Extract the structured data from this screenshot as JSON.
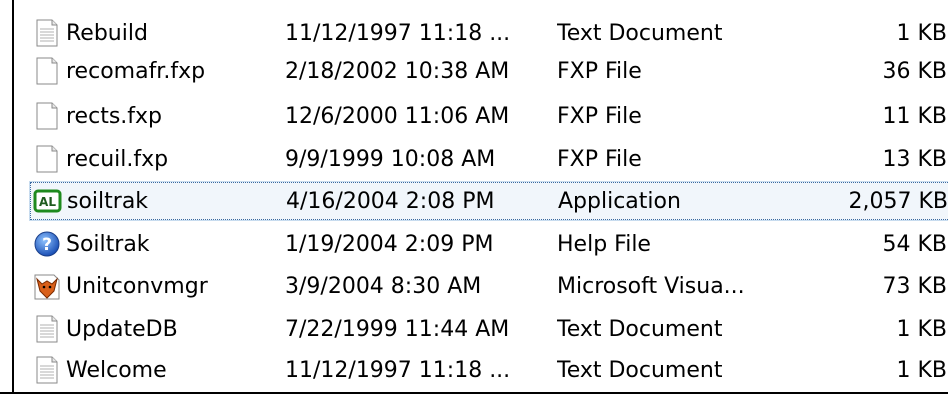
{
  "files": [
    {
      "name": "Rebuild",
      "date": "11/12/1997 11:18 ...",
      "type": "Text Document",
      "size": "1 KB",
      "icon": "text-document-icon"
    },
    {
      "name": "recomafr.fxp",
      "date": "2/18/2002 10:38 AM",
      "type": "FXP File",
      "size": "36 KB",
      "icon": "blank-file-icon"
    },
    {
      "name": "rects.fxp",
      "date": "12/6/2000 11:06 AM",
      "type": "FXP File",
      "size": "11 KB",
      "icon": "blank-file-icon"
    },
    {
      "name": "recuil.fxp",
      "date": "9/9/1999 10:08 AM",
      "type": "FXP File",
      "size": "13 KB",
      "icon": "blank-file-icon"
    },
    {
      "name": "soiltrak",
      "date": "4/16/2004 2:08 PM",
      "type": "Application",
      "size": "2,057 KB",
      "icon": "application-icon"
    },
    {
      "name": "Soiltrak",
      "date": "1/19/2004 2:09 PM",
      "type": "Help File",
      "size": "54 KB",
      "icon": "help-file-icon"
    },
    {
      "name": "Unitconvmgr",
      "date": "3/9/2004 8:30 AM",
      "type": "Microsoft Visua...",
      "size": "73 KB",
      "icon": "foxpro-icon"
    },
    {
      "name": "UpdateDB",
      "date": "7/22/1999 11:44 AM",
      "type": "Text Document",
      "size": "1 KB",
      "icon": "text-document-icon"
    },
    {
      "name": "Welcome",
      "date": "11/12/1997 11:18 ...",
      "type": "Text Document",
      "size": "1 KB",
      "icon": "text-document-icon"
    }
  ],
  "application_icon_label": "AL"
}
